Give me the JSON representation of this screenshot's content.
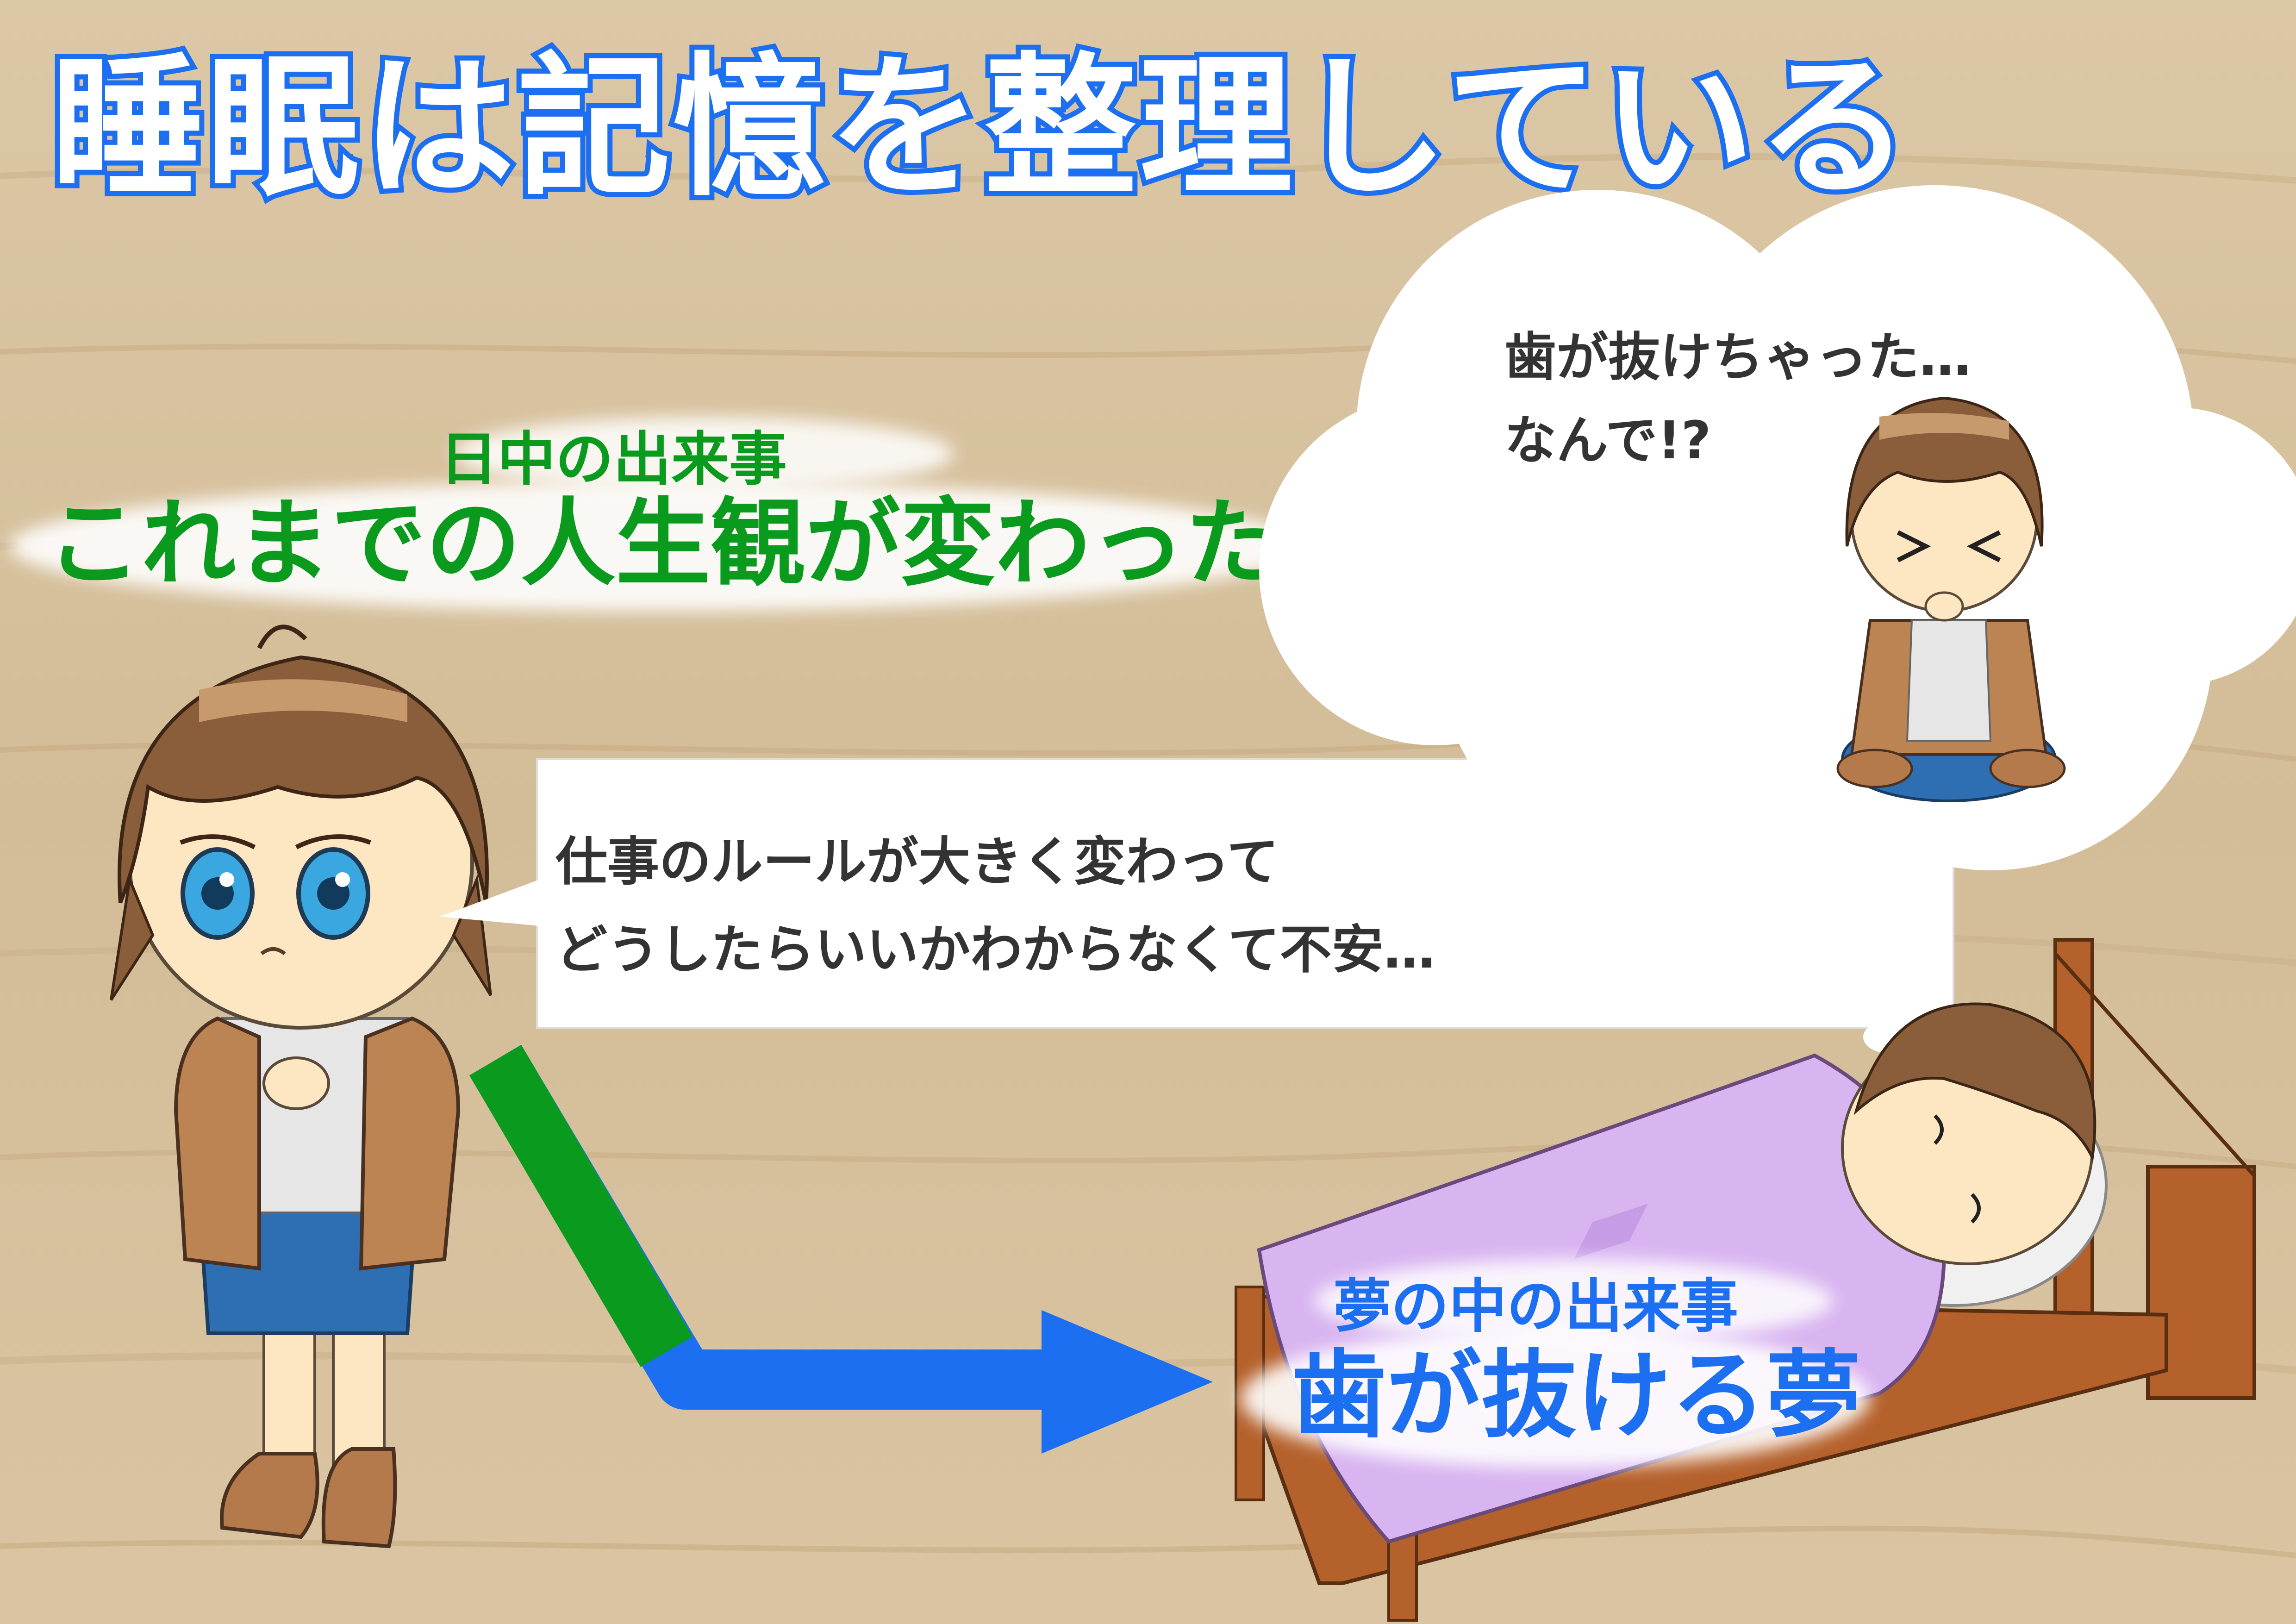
{
  "title": "睡眠は記憶を整理している",
  "daytime": {
    "label": "日中の出来事",
    "event": "これまでの人生観が変わった"
  },
  "speech": {
    "line1": "仕事のルールが大きく変わって",
    "line2": "どうしたらいいかわからなくて不安…"
  },
  "thought": {
    "line1": "歯が抜けちゃった…",
    "line2": "なんで!?"
  },
  "dream": {
    "label": "夢の中の出来事",
    "event": "歯が抜ける夢"
  },
  "colors": {
    "background_wood": "#d6c1a0",
    "title_outline": "#1c6ff0",
    "daytime_text": "#0a9a1e",
    "dream_text": "#1c6ff0",
    "arrow_start": "#0a9a1e",
    "arrow_end": "#1c6ff0",
    "blanket": "#d8b4f0",
    "bed_frame": "#b5612c"
  },
  "icons": {
    "arrow": "right-arrow",
    "worried_person": "worried-person",
    "sleeping_person": "sleeping-person-in-bed",
    "dream_person": "crying-person-sitting"
  }
}
